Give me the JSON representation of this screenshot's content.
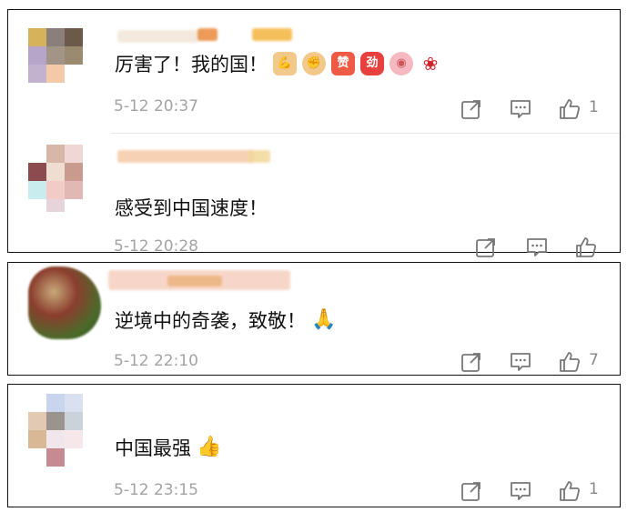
{
  "comments": [
    {
      "text": "厉害了！我的国！",
      "emojis": [
        "flexed-biceps",
        "fist",
        "zan-sticker",
        "jiayou-sticker",
        "pig-face",
        "rose"
      ],
      "time": "5-12 20:37",
      "likes": "1"
    },
    {
      "text": "感受到中国速度！",
      "emojis": [],
      "time": "5-12 20:28",
      "likes": ""
    },
    {
      "text": "逆境中的奇袭，致敬！",
      "emojis": [
        "pray-hands"
      ],
      "time": "5-12 22:10",
      "likes": "7"
    },
    {
      "text": "中国最强",
      "emojis": [
        "thumbs-up"
      ],
      "time": "5-12 23:15",
      "likes": "1"
    }
  ],
  "stickers": {
    "zan": "赞",
    "jiayou": "劲"
  },
  "colors": {
    "text": "#111111",
    "meta": "#a3a3a3",
    "icon": "#777777",
    "border": "#111111"
  }
}
